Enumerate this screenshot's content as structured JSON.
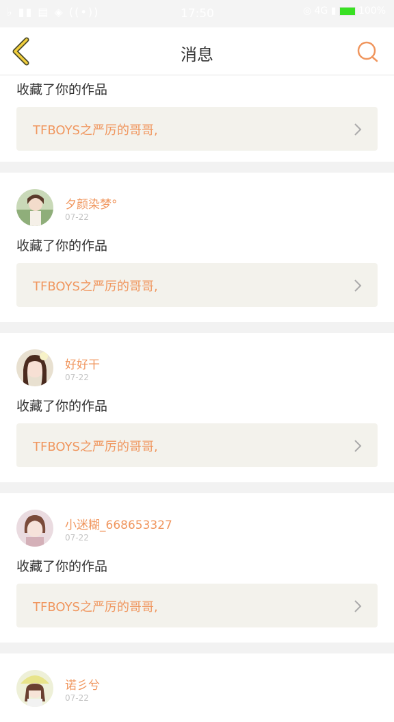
{
  "status_bar": {
    "time": "17:50",
    "battery": "100%",
    "left_icons": "♭ ▮▮ ▤ ◈ ((•))",
    "right_icons": "◎ 4G ▮"
  },
  "header": {
    "title": "消息",
    "back_icon": "chevron-left-icon",
    "search_icon": "search-icon"
  },
  "accent_color": "#f0965e",
  "items": [
    {
      "action": "收藏了你的作品",
      "work_title": "TFBOYS之严厉的哥哥,"
    },
    {
      "user": "夕颜染梦°",
      "date": "07-22",
      "action": "收藏了你的作品",
      "work_title": "TFBOYS之严厉的哥哥,"
    },
    {
      "user": "好好干",
      "date": "07-22",
      "action": "收藏了你的作品",
      "work_title": "TFBOYS之严厉的哥哥,"
    },
    {
      "user": "小迷糊_668653327",
      "date": "07-22",
      "action": "收藏了你的作品",
      "work_title": "TFBOYS之严厉的哥哥,"
    },
    {
      "user": "诺彡兮",
      "date": "07-22"
    }
  ]
}
